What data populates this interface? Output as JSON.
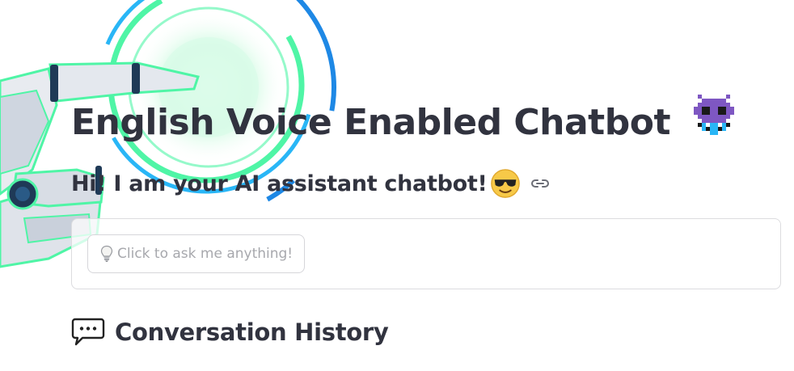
{
  "header": {
    "title": "English Voice Enabled Chatbot",
    "title_emoji": "alien-monster",
    "subtitle": "Hi! I am your AI assistant chatbot!",
    "subtitle_emoji": "smiling-face-with-sunglasses",
    "anchor_icon": "link-icon"
  },
  "ask": {
    "button_label": "Click to ask me anything!",
    "button_icon": "lightbulb-icon"
  },
  "history": {
    "title": "Conversation History",
    "icon": "speech-balloon-icon"
  },
  "colors": {
    "text": "#31333f",
    "muted": "#a7a8ad",
    "border": "#dcdcdf",
    "ring_blue": "#1e88e5",
    "ring_green": "#4ff5a6",
    "ring_cyan": "#29b6f6",
    "alien_purple": "#7e57c2"
  },
  "background_art": "robot-hand-with-glowing-rings"
}
